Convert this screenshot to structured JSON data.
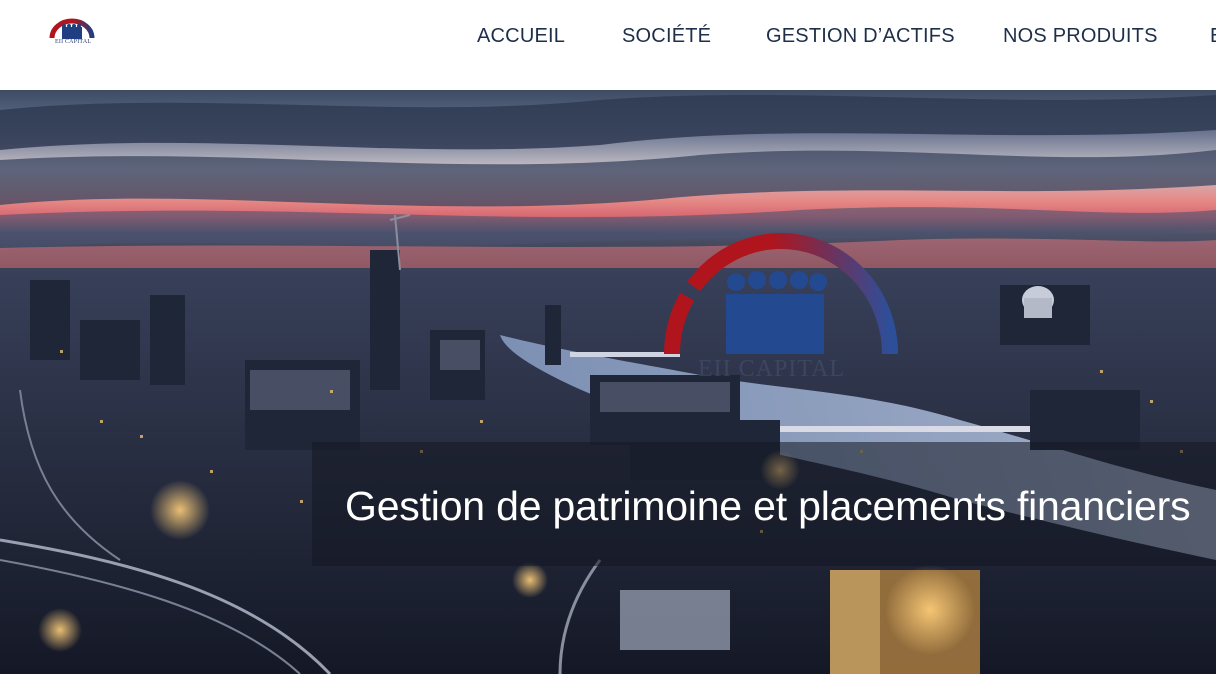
{
  "brand": {
    "logo_text": "EII CAPITAL",
    "colors": {
      "red": "#b0141c",
      "navy": "#1f3f82",
      "nav_text": "#1e2f4a"
    }
  },
  "nav": {
    "items": [
      {
        "label": "ACCUEIL"
      },
      {
        "label": "SOCIÉTÉ"
      },
      {
        "label": "GESTION D’ACTIFS"
      },
      {
        "label": "NOS PRODUITS"
      },
      {
        "label": "E"
      }
    ]
  },
  "hero": {
    "watermark_text": "EII CAPITAL",
    "headline": "Gestion de patrimoine et placements financiers"
  },
  "icons": {
    "logo": "eii-capital-logo-icon",
    "hero_emblem": "eii-capital-emblem-icon"
  }
}
